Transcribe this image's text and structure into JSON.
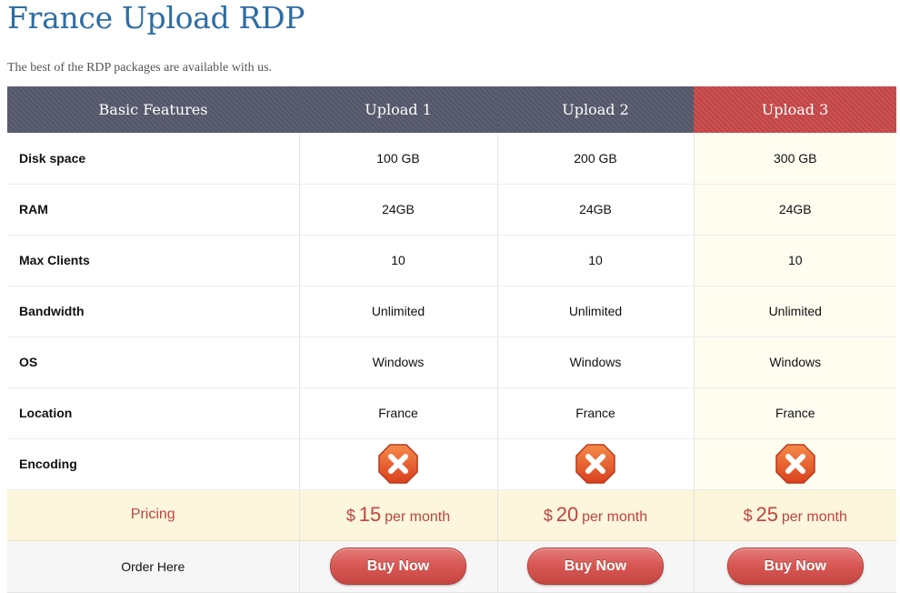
{
  "page": {
    "title": "France Upload RDP",
    "subtitle": "The best of the RDP packages are available with us."
  },
  "table": {
    "headers": [
      "Basic Features",
      "Upload 1",
      "Upload 2",
      "Upload 3"
    ],
    "rows": [
      {
        "label": "Disk space",
        "values": [
          "100 GB",
          "200 GB",
          "300 GB"
        ]
      },
      {
        "label": "RAM",
        "values": [
          "24GB",
          "24GB",
          "24GB"
        ]
      },
      {
        "label": "Max Clients",
        "values": [
          "10",
          "10",
          "10"
        ]
      },
      {
        "label": "Bandwidth",
        "values": [
          "Unlimited",
          "Unlimited",
          "Unlimited"
        ]
      },
      {
        "label": "OS",
        "values": [
          "Windows",
          "Windows",
          "Windows"
        ]
      },
      {
        "label": "Location",
        "values": [
          "France",
          "France",
          "France"
        ]
      }
    ],
    "encoding": {
      "label": "Encoding",
      "icon": "cross-octagon-icon",
      "available": [
        false,
        false,
        false
      ]
    },
    "pricing": {
      "label": "Pricing",
      "currency": "$",
      "amounts": [
        "15",
        "20",
        "25"
      ],
      "period": "per month"
    },
    "order": {
      "label": "Order Here",
      "button_label": "Buy Now"
    }
  },
  "colors": {
    "title": "#2e6da4",
    "header_bg": "#565a6c",
    "featured_header_bg": "#c9494a",
    "price": "#c1443f",
    "button": "#d85955",
    "cross_icon": "#e8502a"
  }
}
